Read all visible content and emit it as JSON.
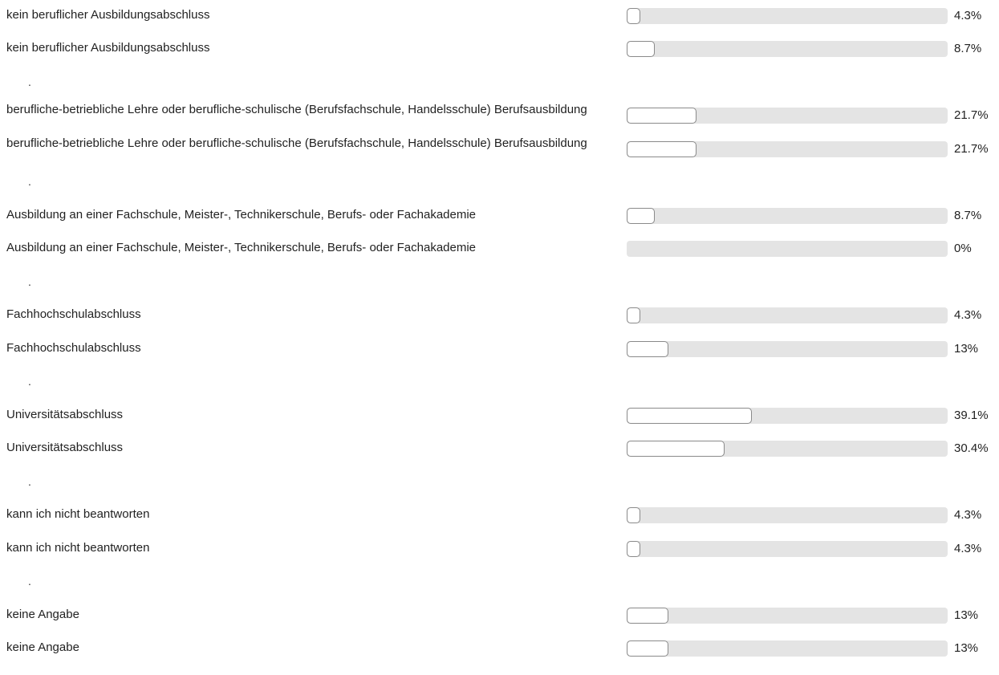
{
  "rows": [
    {
      "type": "bar",
      "label": "kein beruflicher Ausbildungsabschluss",
      "percent_text": "4.3%",
      "value": 4.3
    },
    {
      "type": "bar",
      "label": "kein beruflicher Ausbildungsabschluss",
      "percent_text": "8.7%",
      "value": 8.7
    },
    {
      "type": "sep",
      "text": "."
    },
    {
      "type": "bar",
      "label": "berufliche-betriebliche Lehre oder berufliche-schulische (Berufsfachschule, Handelsschule) Berufsausbildung",
      "percent_text": "21.7%",
      "value": 21.7
    },
    {
      "type": "bar",
      "label": "berufliche-betriebliche Lehre oder berufliche-schulische (Berufsfachschule, Handelsschule) Berufsausbildung",
      "percent_text": "21.7%",
      "value": 21.7
    },
    {
      "type": "sep",
      "text": "."
    },
    {
      "type": "bar",
      "label": "Ausbildung an einer Fachschule, Meister-, Technikerschule, Berufs- oder Fachakademie",
      "percent_text": "8.7%",
      "value": 8.7
    },
    {
      "type": "bar",
      "label": "Ausbildung an einer Fachschule, Meister-, Technikerschule, Berufs- oder Fachakademie",
      "percent_text": "0%",
      "value": 0
    },
    {
      "type": "sep",
      "text": "."
    },
    {
      "type": "bar",
      "label": "Fachhochschulabschluss",
      "percent_text": "4.3%",
      "value": 4.3
    },
    {
      "type": "bar",
      "label": "Fachhochschulabschluss",
      "percent_text": "13%",
      "value": 13
    },
    {
      "type": "sep",
      "text": "."
    },
    {
      "type": "bar",
      "label": "Universitätsabschluss",
      "percent_text": "39.1%",
      "value": 39.1
    },
    {
      "type": "bar",
      "label": "Universitätsabschluss",
      "percent_text": "30.4%",
      "value": 30.4
    },
    {
      "type": "sep",
      "text": "."
    },
    {
      "type": "bar",
      "label": "kann ich nicht beantworten",
      "percent_text": "4.3%",
      "value": 4.3
    },
    {
      "type": "bar",
      "label": "kann ich nicht beantworten",
      "percent_text": "4.3%",
      "value": 4.3
    },
    {
      "type": "sep",
      "text": "."
    },
    {
      "type": "bar",
      "label": "keine Angabe",
      "percent_text": "13%",
      "value": 13
    },
    {
      "type": "bar",
      "label": "keine Angabe",
      "percent_text": "13%",
      "value": 13
    }
  ]
}
